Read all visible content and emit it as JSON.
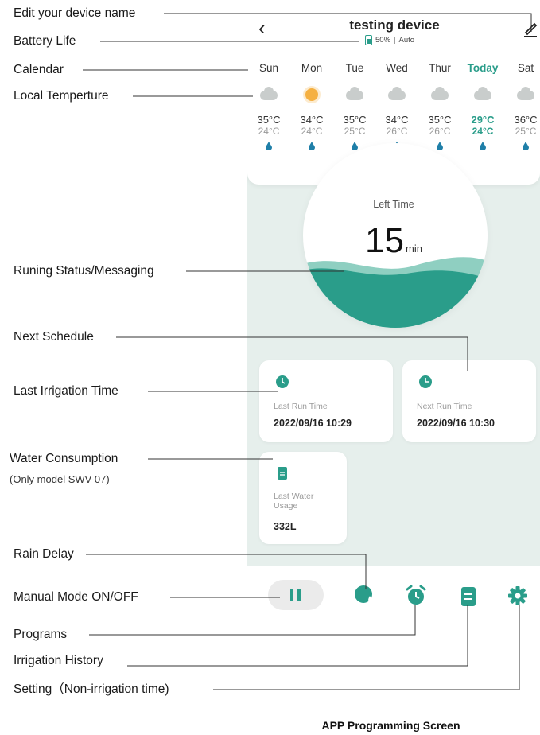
{
  "callouts": {
    "edit_name": "Edit your device name",
    "battery_life": "Battery Life",
    "calendar": "Calendar",
    "local_temp": "Local Temperture",
    "running_status": "Runing Status/Messaging",
    "next_schedule": "Next Schedule",
    "last_irrigation": "Last Irrigation Time",
    "water_consumption": "Water Consumption",
    "water_note": "(Only model SWV-07)",
    "rain_delay": "Rain Delay",
    "manual_mode": "Manual Mode ON/OFF",
    "programs": "Programs",
    "irrigation_history": "Irrigation History",
    "setting": "Setting（Non-irrigation time)"
  },
  "header": {
    "device_name": "testing device",
    "battery_percent": "50%",
    "separator": "|",
    "mode": "Auto"
  },
  "forecast": [
    {
      "day": "Sun",
      "icon": "cloud-icon",
      "high": "35°C",
      "low": "24°C",
      "today": false
    },
    {
      "day": "Mon",
      "icon": "sun-icon",
      "high": "34°C",
      "low": "24°C",
      "today": false
    },
    {
      "day": "Tue",
      "icon": "cloud-icon",
      "high": "35°C",
      "low": "25°C",
      "today": false
    },
    {
      "day": "Wed",
      "icon": "cloud-icon",
      "high": "34°C",
      "low": "26°C",
      "today": false
    },
    {
      "day": "Thur",
      "icon": "cloud-icon",
      "high": "35°C",
      "low": "26°C",
      "today": false
    },
    {
      "day": "Today",
      "icon": "cloud-icon",
      "high": "29°C",
      "low": "24°C",
      "today": true
    },
    {
      "day": "Sat",
      "icon": "cloud-icon",
      "high": "36°C",
      "low": "25°C",
      "today": false
    }
  ],
  "timer": {
    "label": "Left Time",
    "value": "15",
    "unit": "min"
  },
  "cards": {
    "last_run_label": "Last Run Time",
    "last_run_value": "2022/09/16 10:29",
    "next_run_label": "Next Run Time",
    "next_run_value": "2022/09/16 10:30",
    "water_label_1": "Last Water",
    "water_label_2": "Usage",
    "water_value": "332L"
  },
  "footer": {
    "caption": "APP Programming Screen"
  },
  "colors": {
    "accent": "#2a9d8a",
    "screen_bg": "#e6efec"
  }
}
